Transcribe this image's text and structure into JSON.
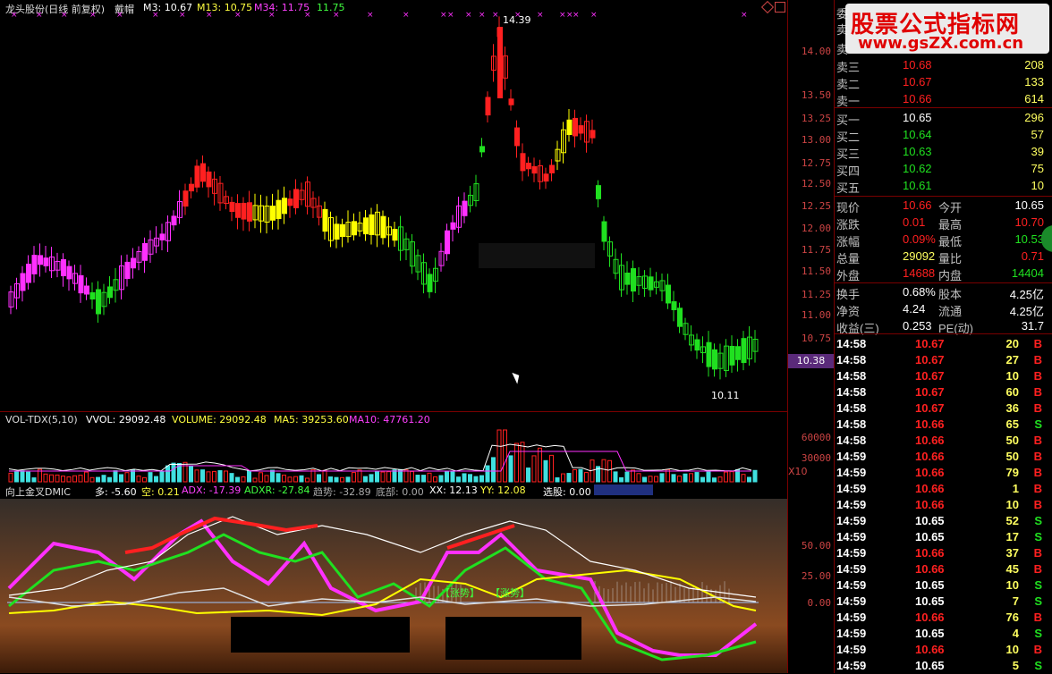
{
  "main_header": {
    "stock": "龙头股份(日线 前复权)",
    "wear": "戴帽",
    "m3": "M3: 10.67",
    "m13": "M13: 10.75",
    "m34": "M34: 11.75",
    "m34b": "11.75"
  },
  "price_axis": [
    "14.00",
    "13.50",
    "13.25",
    "13.00",
    "12.75",
    "12.50",
    "12.25",
    "12.00",
    "11.75",
    "11.50",
    "11.25",
    "11.00",
    "10.75"
  ],
  "price_marker": "10.38",
  "high_label": "14.39",
  "low_label": "10.11",
  "volume_header": {
    "name": "VOL-TDX(5,10)",
    "vvol": "VVOL: 29092.48",
    "volume": "VOLUME: 29092.48",
    "ma5": "MA5: 39253.60",
    "ma10": "MA10: 47761.20"
  },
  "volume_axis": [
    "60000",
    "30000"
  ],
  "volume_unit": "X10",
  "indicator_header": {
    "name": "向上金叉DMIC",
    "duo": "多: -5.60",
    "kong": "空: 0.21",
    "adx": "ADX: -17.39",
    "adxr": "ADXR: -27.84",
    "trend": "趋势: -32.89",
    "bottom": "底部: 0.00",
    "xx": "XX: 12.13",
    "yy": "YY: 12.08",
    "pick": "选股: 0.00"
  },
  "indicator_axis": [
    "50.00",
    "25.00",
    "0.00"
  ],
  "ind_labels": [
    "【涨势】",
    "【涨势】"
  ],
  "watermark": {
    "title": "股票公式指标网",
    "url": "www.gsZX.com.cn"
  },
  "order_book": {
    "sell_partial": [
      "委",
      "卖",
      "卖"
    ],
    "sells": [
      {
        "label": "卖三",
        "price": "10.68",
        "vol": "208"
      },
      {
        "label": "卖二",
        "price": "10.67",
        "vol": "133"
      },
      {
        "label": "卖一",
        "price": "10.66",
        "vol": "614"
      }
    ],
    "buys": [
      {
        "label": "买一",
        "price": "10.65",
        "vol": "296"
      },
      {
        "label": "买二",
        "price": "10.64",
        "vol": "57"
      },
      {
        "label": "买三",
        "price": "10.63",
        "vol": "39"
      },
      {
        "label": "买四",
        "price": "10.62",
        "vol": "75"
      },
      {
        "label": "买五",
        "price": "10.61",
        "vol": "10"
      }
    ]
  },
  "stats": [
    {
      "l1": "现价",
      "v1": "10.66",
      "l2": "今开",
      "v2": "10.65"
    },
    {
      "l1": "涨跌",
      "v1": "0.01",
      "l2": "最高",
      "v2": "10.70"
    },
    {
      "l1": "涨幅",
      "v1": "0.09%",
      "l2": "最低",
      "v2": "10.53"
    },
    {
      "l1": "总量",
      "v1": "29092",
      "l2": "量比",
      "v2": "0.71"
    },
    {
      "l1": "外盘",
      "v1": "14688",
      "l2": "内盘",
      "v2": "14404"
    }
  ],
  "finance": [
    {
      "l1": "换手",
      "v1": "0.68%",
      "l2": "股本",
      "v2": "4.25亿"
    },
    {
      "l1": "净资",
      "v1": "4.24",
      "l2": "流通",
      "v2": "4.25亿"
    },
    {
      "l1": "收益(三)",
      "v1": "0.253",
      "l2": "PE(动)",
      "v2": "31.7"
    }
  ],
  "ticks": [
    {
      "t": "14:58",
      "p": "10.67",
      "v": "20",
      "s": "B"
    },
    {
      "t": "14:58",
      "p": "10.67",
      "v": "27",
      "s": "B"
    },
    {
      "t": "14:58",
      "p": "10.67",
      "v": "10",
      "s": "B"
    },
    {
      "t": "14:58",
      "p": "10.67",
      "v": "60",
      "s": "B"
    },
    {
      "t": "14:58",
      "p": "10.67",
      "v": "36",
      "s": "B"
    },
    {
      "t": "14:58",
      "p": "10.66",
      "v": "65",
      "s": "S"
    },
    {
      "t": "14:58",
      "p": "10.66",
      "v": "50",
      "s": "B"
    },
    {
      "t": "14:59",
      "p": "10.66",
      "v": "50",
      "s": "B"
    },
    {
      "t": "14:59",
      "p": "10.66",
      "v": "79",
      "s": "B"
    },
    {
      "t": "14:59",
      "p": "10.66",
      "v": "1",
      "s": "B"
    },
    {
      "t": "14:59",
      "p": "10.66",
      "v": "10",
      "s": "B"
    },
    {
      "t": "14:59",
      "p": "10.65",
      "v": "52",
      "s": "S"
    },
    {
      "t": "14:59",
      "p": "10.65",
      "v": "17",
      "s": "S"
    },
    {
      "t": "14:59",
      "p": "10.66",
      "v": "37",
      "s": "B"
    },
    {
      "t": "14:59",
      "p": "10.66",
      "v": "45",
      "s": "B"
    },
    {
      "t": "14:59",
      "p": "10.65",
      "v": "10",
      "s": "S"
    },
    {
      "t": "14:59",
      "p": "10.65",
      "v": "7",
      "s": "S"
    },
    {
      "t": "14:59",
      "p": "10.66",
      "v": "76",
      "s": "B"
    },
    {
      "t": "14:59",
      "p": "10.65",
      "v": "4",
      "s": "S"
    },
    {
      "t": "14:59",
      "p": "10.66",
      "v": "10",
      "s": "B"
    },
    {
      "t": "14:59",
      "p": "10.65",
      "v": "5",
      "s": "S"
    }
  ],
  "colors": {
    "up": "#ff2020",
    "down": "#20e020",
    "magenta": "#ff30ff",
    "yellow": "#ffff00",
    "cyan": "#40e0e0",
    "white": "#ffffff",
    "frame": "#7a0000",
    "label": "#c0c0c0"
  }
}
